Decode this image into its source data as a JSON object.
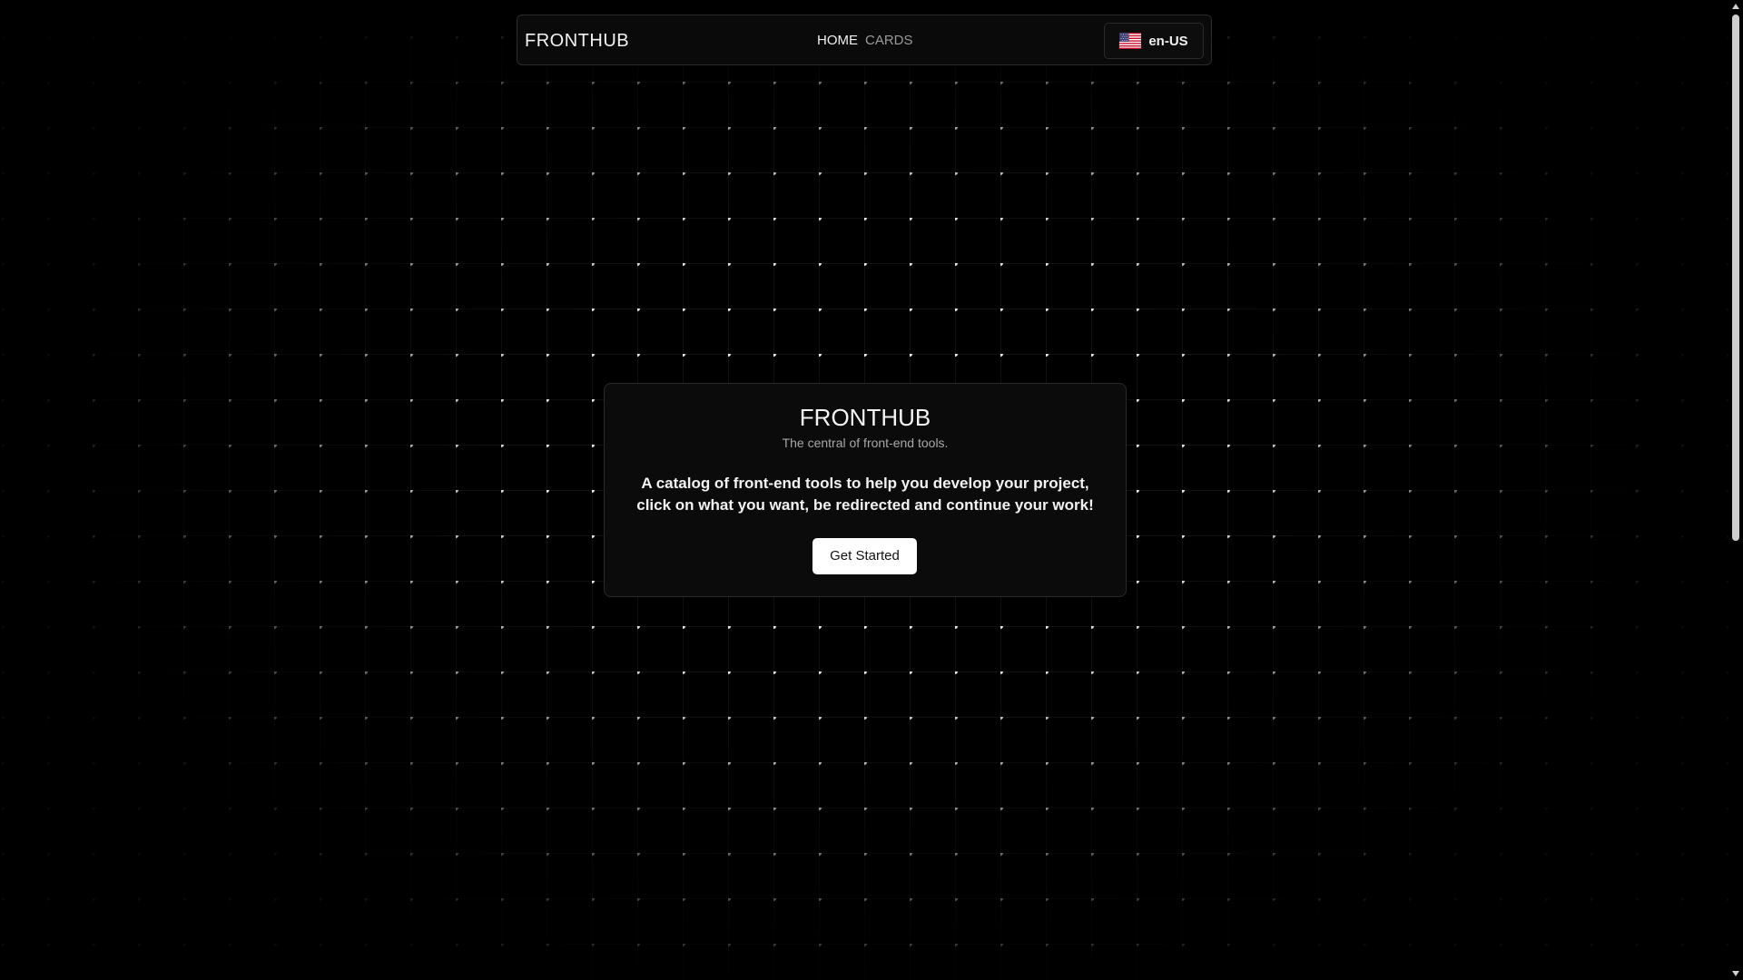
{
  "navbar": {
    "brand": "FRONTHUB",
    "links": [
      {
        "label": "HOME",
        "active": true
      },
      {
        "label": "CARDS",
        "active": false
      }
    ],
    "language": {
      "label": "en-US",
      "flag_icon": "us-flag-icon"
    }
  },
  "hero": {
    "title": "FRONTHUB",
    "subtitle": "The central of front-end tools.",
    "description": "A catalog of front-end tools to help you develop your project, click on what you want, be redirected and continue your work!",
    "cta_label": "Get Started"
  },
  "colors": {
    "background": "#000000",
    "grid_dot": "#ffffff",
    "card_background": "#0b0b0b",
    "card_border": "#2a2a2a",
    "cta_background": "#ffffff",
    "cta_text": "#111111"
  }
}
